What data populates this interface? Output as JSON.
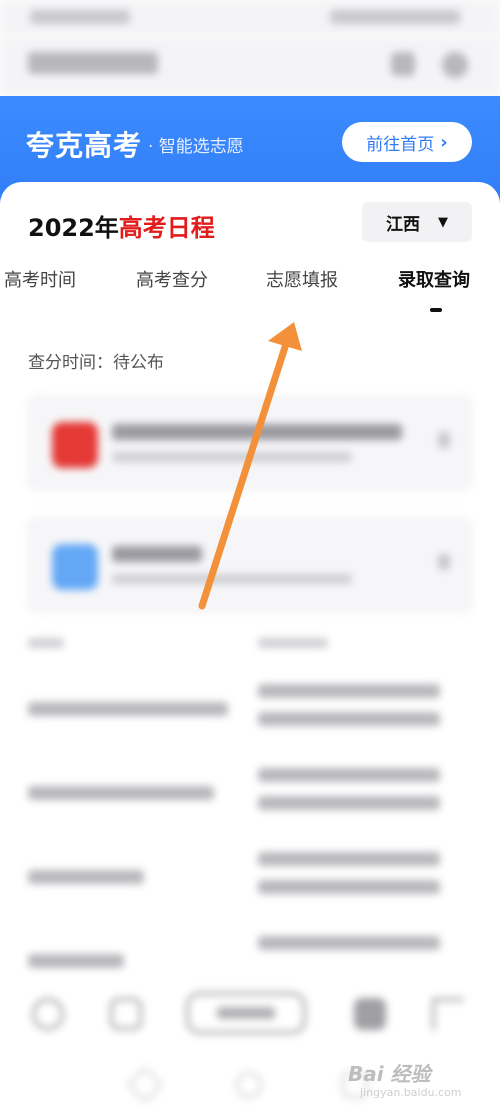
{
  "banner": {
    "brand": "夸克高考",
    "slogan": "· 智能选志愿",
    "button_label": "前往首页",
    "button_chevron": "›",
    "bg_color": "#2f7cf6"
  },
  "card": {
    "title_year": "2022年",
    "title_highlight": "高考日程",
    "highlight_color": "#e21b1b",
    "region": "江西",
    "region_caret": "▼"
  },
  "tabs": [
    {
      "label": "高考时间",
      "active": false
    },
    {
      "label": "高考查分",
      "active": false
    },
    {
      "label": "志愿填报",
      "active": false
    },
    {
      "label": "录取查询",
      "active": true
    }
  ],
  "score_time": "查分时间：待公布",
  "icons": {
    "card1": "app-red-icon",
    "card2": "app-blue-icon",
    "arrow": "annotation-arrow-icon"
  },
  "colors": {
    "arrow": "#f3913a",
    "card1_icon": "#e53935",
    "card2_icon": "#64a8f5"
  },
  "watermark": {
    "text": "Bai 经验",
    "sub": "jingyan.baidu.com"
  }
}
